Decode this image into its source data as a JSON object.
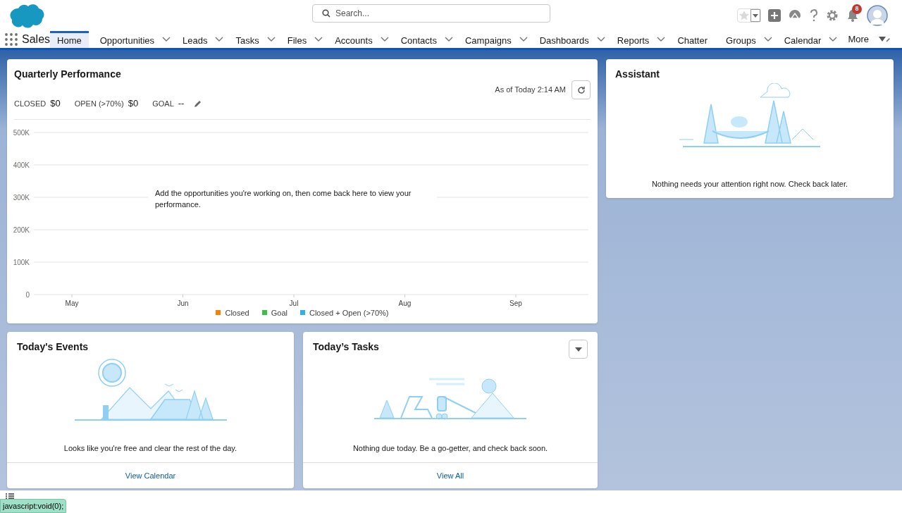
{
  "header": {
    "search": {
      "placeholder": "Search..."
    },
    "notifications": {
      "badge": "8"
    }
  },
  "app_name": "Sales",
  "nav": {
    "items": [
      {
        "label": "Home",
        "selected": true,
        "has_menu": false
      },
      {
        "label": "Opportunities",
        "selected": false,
        "has_menu": true
      },
      {
        "label": "Leads",
        "selected": false,
        "has_menu": true
      },
      {
        "label": "Tasks",
        "selected": false,
        "has_menu": true
      },
      {
        "label": "Files",
        "selected": false,
        "has_menu": true
      },
      {
        "label": "Accounts",
        "selected": false,
        "has_menu": true
      },
      {
        "label": "Contacts",
        "selected": false,
        "has_menu": true
      },
      {
        "label": "Campaigns",
        "selected": false,
        "has_menu": true
      },
      {
        "label": "Dashboards",
        "selected": false,
        "has_menu": true
      },
      {
        "label": "Reports",
        "selected": false,
        "has_menu": true
      },
      {
        "label": "Chatter",
        "selected": false,
        "has_menu": false
      },
      {
        "label": "Groups",
        "selected": false,
        "has_menu": true
      },
      {
        "label": "Calendar",
        "selected": false,
        "has_menu": true
      }
    ],
    "more": "More"
  },
  "quarterly_performance": {
    "title": "Quarterly Performance",
    "as_of": "As of Today 2:14 AM",
    "metrics": [
      {
        "label": "CLOSED",
        "value": "$0"
      },
      {
        "label": "OPEN (>70%)",
        "value": "$0"
      },
      {
        "label": "GOAL",
        "value": "--"
      }
    ],
    "empty_message": "Add the opportunities you're working on, then come back here to view your performance.",
    "chart_data": {
      "type": "line",
      "grid": true,
      "categories": [
        "May",
        "Jun",
        "Jul",
        "Aug",
        "Sep"
      ],
      "yticks": [
        {
          "value": 0,
          "label": "0"
        },
        {
          "value": 100000,
          "label": "100K"
        },
        {
          "value": 200000,
          "label": "200K"
        },
        {
          "value": 300000,
          "label": "300K"
        },
        {
          "value": 400000,
          "label": "400K"
        },
        {
          "value": 500000,
          "label": "500K"
        }
      ],
      "ylim": [
        0,
        500000
      ],
      "series": [
        {
          "name": "Closed",
          "color": "#f38303",
          "values": [
            null,
            null,
            null,
            null,
            null
          ]
        },
        {
          "name": "Goal",
          "color": "#3ebe47",
          "values": [
            null,
            null,
            null,
            null,
            null
          ]
        },
        {
          "name": "Closed + Open (>70%)",
          "color": "#2fb0e6",
          "values": [
            null,
            null,
            null,
            null,
            null
          ]
        }
      ]
    }
  },
  "assistant": {
    "title": "Assistant",
    "message": "Nothing needs your attention right now. Check back later."
  },
  "todays_events": {
    "title": "Today's Events",
    "message": "Looks like you're free and clear the rest of the day.",
    "link": "View Calendar"
  },
  "todays_tasks": {
    "title": "Today’s Tasks",
    "message": "Nothing due today. Be a go-getter, and check back soon.",
    "link": "View All"
  },
  "status_url": "javascript:void(0);"
}
